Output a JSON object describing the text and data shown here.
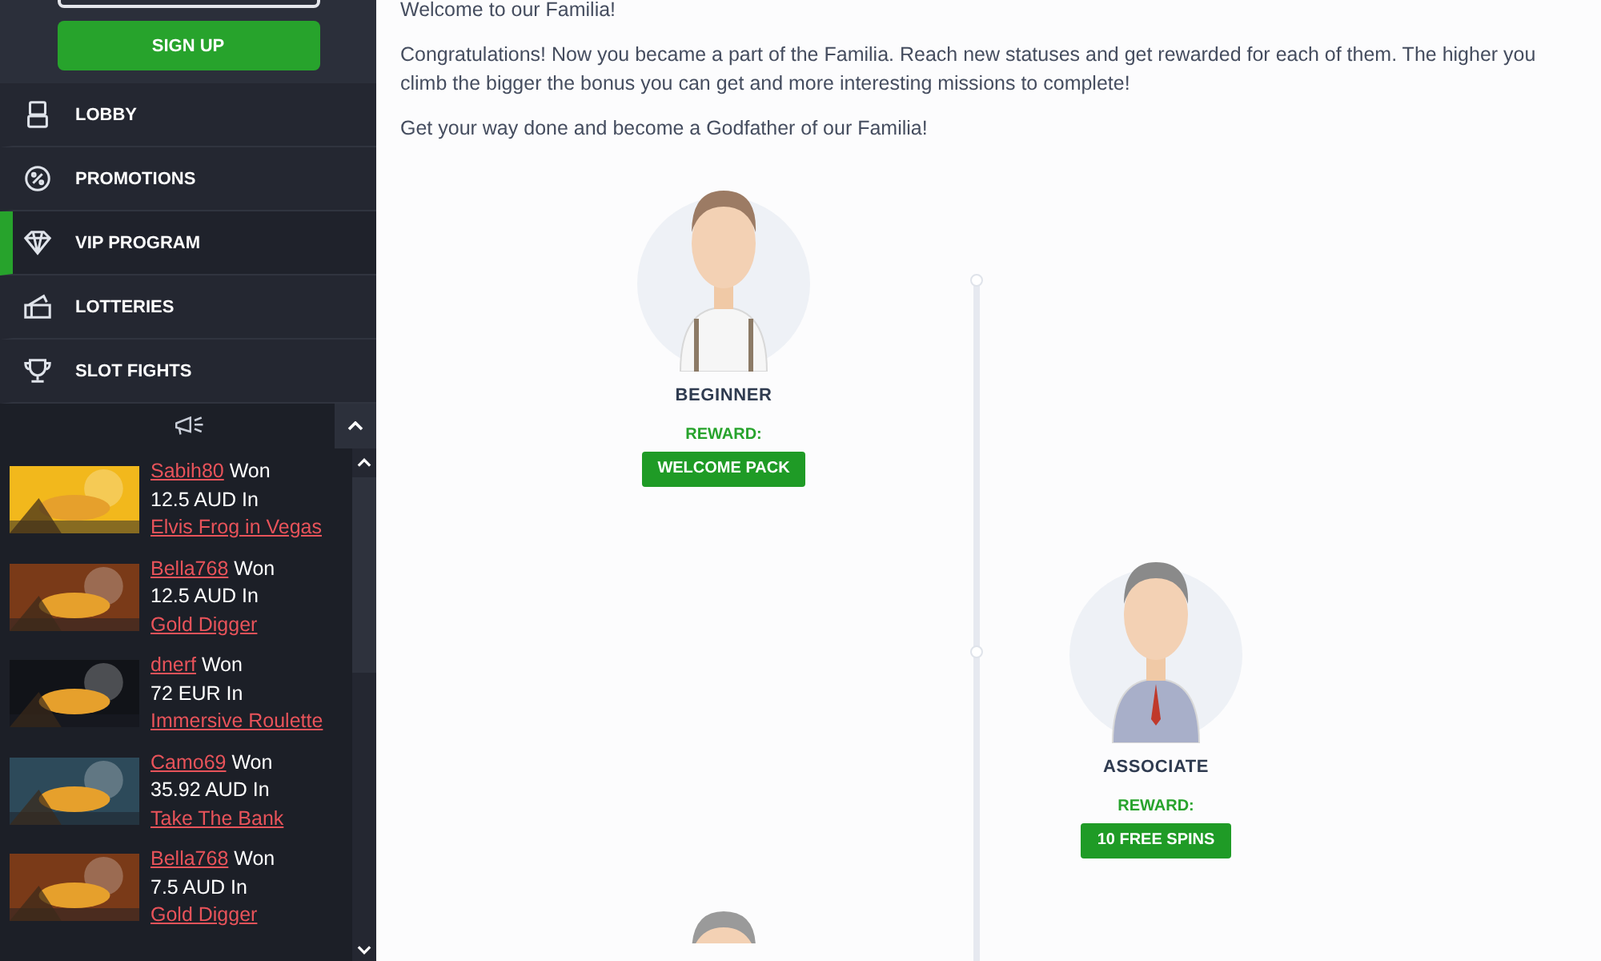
{
  "sidebar": {
    "signup_button": "SIGN UP",
    "nav": [
      {
        "label": "LOBBY",
        "selected": false
      },
      {
        "label": "PROMOTIONS",
        "selected": false
      },
      {
        "label": "VIP PROGRAM",
        "selected": true
      },
      {
        "label": "LOTTERIES",
        "selected": false
      },
      {
        "label": "SLOT FIGHTS",
        "selected": false
      }
    ],
    "winners": [
      {
        "user": "Sabih80",
        "won": "Won",
        "amount": "12.5 AUD In",
        "game": "Elvis Frog in Vegas"
      },
      {
        "user": "Bella768",
        "won": "Won",
        "amount": "12.5 AUD In",
        "game": "Gold Digger"
      },
      {
        "user": "dnerf",
        "won": "Won",
        "amount": "72 EUR In",
        "game": "Immersive Roulette"
      },
      {
        "user": "Camo69",
        "won": "Won",
        "amount": "35.92 AUD In",
        "game": "Take The Bank"
      },
      {
        "user": "Bella768",
        "won": "Won",
        "amount": "7.5 AUD In",
        "game": "Gold Digger"
      }
    ]
  },
  "main": {
    "paragraphs": [
      "Welcome to our Familia!",
      "Congratulations! Now you became a part of the Familia. Reach new statuses and get rewarded for each of them. The higher you climb the bigger the bonus you can get and more interesting missions to complete!",
      "Get your way done and become a Godfather of our Familia!"
    ],
    "tiers": [
      {
        "kind": "full",
        "name": "BEGINNER",
        "reward_label": "REWARD:",
        "reward": "WELCOME PACK"
      },
      {
        "kind": "full",
        "name": "ASSOCIATE",
        "reward_label": "REWARD:",
        "reward": "10 FREE SPINS"
      },
      {
        "kind": "partial"
      }
    ]
  }
}
